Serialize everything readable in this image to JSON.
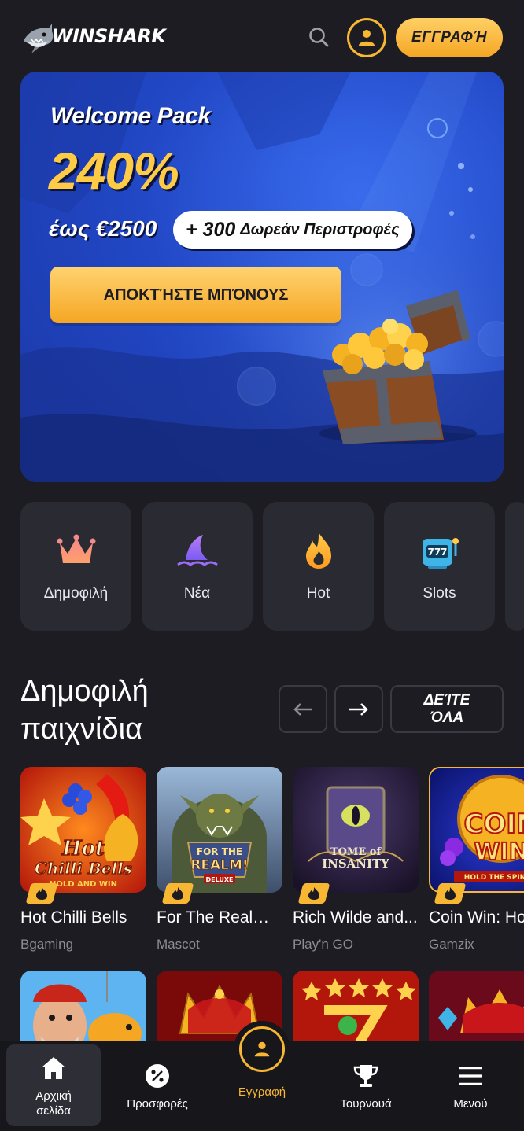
{
  "header": {
    "logo_text": "WINSHARK",
    "register_label": "ΕΓΓΡΑΦΉ"
  },
  "banner": {
    "title": "Welcome Pack",
    "percent": "240%",
    "upto": "έως €2500",
    "spins_num": "+ 300",
    "spins_text": "Δωρεάν Περιστροφές",
    "cta_label": "ΑΠΟΚΤΉΣΤΕ ΜΠΌΝΟΥΣ"
  },
  "categories": [
    {
      "label": "Δημοφιλή",
      "icon": "crown-icon"
    },
    {
      "label": "Νέα",
      "icon": "shark-fin-icon"
    },
    {
      "label": "Hot",
      "icon": "flame-icon"
    },
    {
      "label": "Slots",
      "icon": "slot-machine-icon"
    }
  ],
  "section": {
    "title_line1": "Δημοφιλή",
    "title_line2": "παιχνίδια",
    "see_all_line1": "ΔΕΊΤΕ",
    "see_all_line2": "ΌΛΑ"
  },
  "games": [
    {
      "name": "Hot Chilli Bells",
      "provider": "Bgaming",
      "thumb_text1": "Hot",
      "thumb_text2": "Chilli Bells",
      "thumb_text3": "HOLD AND WIN"
    },
    {
      "name": "For The Realm ...",
      "provider": "Mascot",
      "thumb_text1": "FOR THE",
      "thumb_text2": "REALM!",
      "thumb_text3": "DELUXE"
    },
    {
      "name": "Rich Wilde and...",
      "provider": "Play'n GO",
      "thumb_text1": "TOME of",
      "thumb_text2": "INSANITY",
      "thumb_text3": ""
    },
    {
      "name": "Coin Win: Ho",
      "provider": "Gamzix",
      "thumb_text1": "COIN",
      "thumb_text2": "WIN",
      "thumb_text3": "HOLD THE SPIN"
    }
  ],
  "bottom_nav": {
    "home_line1": "Αρχική",
    "home_line2": "σελίδα",
    "promos": "Προσφορές",
    "register": "Εγγραφή",
    "tournaments": "Τουρνουά",
    "menu": "Μενού"
  },
  "colors": {
    "accent": "#f7b733",
    "background": "#1c1c22",
    "card": "#2a2a33",
    "banner_blue": "#2248c6"
  }
}
